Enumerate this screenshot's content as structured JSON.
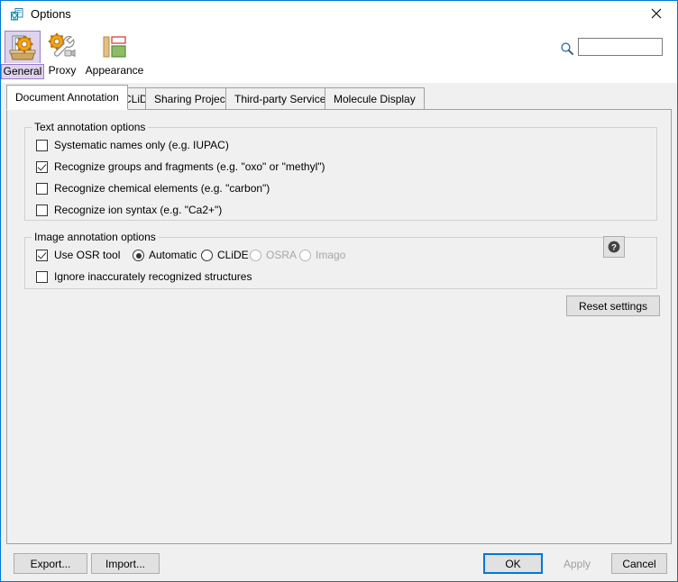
{
  "window": {
    "title": "Options",
    "title_icon": "options-document-icon",
    "close_icon": "close-icon",
    "accent_color": "#0078d7",
    "background_color": "#f0f0f0"
  },
  "toolbar": {
    "items": [
      {
        "label": "General",
        "icon": "general-folder-gear-icon",
        "selected": true
      },
      {
        "label": "Proxy",
        "icon": "proxy-gear-wrench-icon",
        "selected": false
      },
      {
        "label": "Appearance",
        "icon": "appearance-layout-icon",
        "selected": false
      }
    ]
  },
  "search": {
    "icon": "search-icon",
    "value": "",
    "placeholder": ""
  },
  "tabs": [
    {
      "label": "Document Annotation",
      "active": true
    },
    {
      "label": "CLiDE",
      "active": false
    },
    {
      "label": "Sharing Projects",
      "active": false
    },
    {
      "label": "Third-party Services",
      "active": false
    },
    {
      "label": "Molecule Display",
      "active": false
    }
  ],
  "text_annotation": {
    "title": "Text annotation options",
    "options": [
      {
        "label": "Systematic names only (e.g. IUPAC)",
        "checked": false
      },
      {
        "label": "Recognize groups and fragments (e.g. \"oxo\" or \"methyl\")",
        "checked": true
      },
      {
        "label": "Recognize chemical elements (e.g. \"carbon\")",
        "checked": false
      },
      {
        "label": "Recognize ion syntax (e.g. \"Ca2+\")",
        "checked": false
      }
    ]
  },
  "image_annotation": {
    "title": "Image annotation options",
    "use_osr_tool": {
      "label": "Use OSR tool",
      "checked": true
    },
    "osr_engines": [
      {
        "label": "Automatic",
        "selected": true,
        "disabled": false
      },
      {
        "label": "CLiDE",
        "selected": false,
        "disabled": false
      },
      {
        "label": "OSRA",
        "selected": false,
        "disabled": true
      },
      {
        "label": "Imago",
        "selected": false,
        "disabled": true
      }
    ],
    "ignore_inaccurate": {
      "label": "Ignore inaccurately recognized structures",
      "checked": false
    },
    "help_button": {
      "icon": "help-question-icon",
      "label": ""
    }
  },
  "reset_button": {
    "label": "Reset settings"
  },
  "footer": {
    "export_label": "Export...",
    "import_label": "Import...",
    "ok_label": "OK",
    "apply_label": "Apply",
    "cancel_label": "Cancel",
    "apply_disabled": true,
    "ok_is_default": true
  }
}
